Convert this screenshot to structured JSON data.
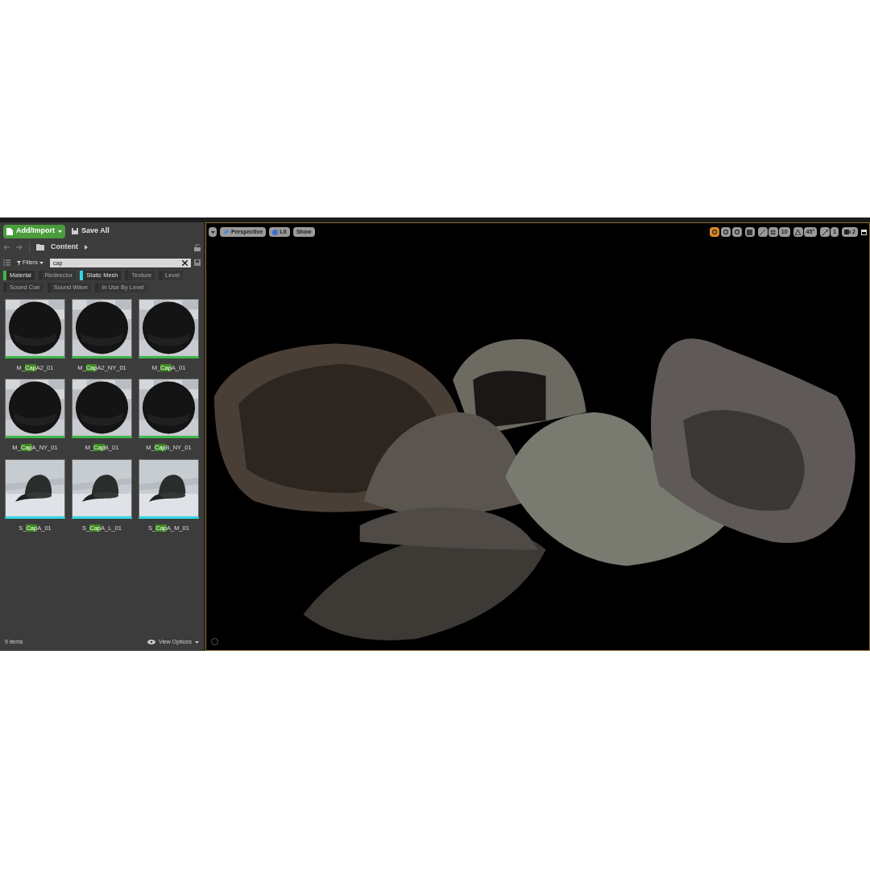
{
  "toolbar": {
    "add_button": "Add/Import",
    "save_button": "Save All"
  },
  "path": {
    "folder": "Content"
  },
  "search": {
    "value": "cap",
    "filters_label": "Filters"
  },
  "filters": [
    {
      "label": "Material",
      "active": true,
      "color": "#3fb64a"
    },
    {
      "label": "Redirector",
      "active": false
    },
    {
      "label": "Static Mesh",
      "active": true,
      "color": "#33d6e6"
    },
    {
      "label": "Texture",
      "active": false
    },
    {
      "label": "Level",
      "active": false
    },
    {
      "label": "Sound Cue",
      "active": false
    },
    {
      "label": "Sound Wave",
      "active": false
    },
    {
      "label": "In Use By Level",
      "active": false
    }
  ],
  "assets": [
    {
      "kind": "material",
      "prefix": "M_",
      "match": "Cap",
      "suffix": "A2_01"
    },
    {
      "kind": "material",
      "prefix": "M_",
      "match": "Cap",
      "suffix": "A2_NY_01"
    },
    {
      "kind": "material",
      "prefix": "M_",
      "match": "Cap",
      "suffix": "A_01"
    },
    {
      "kind": "material",
      "prefix": "M_",
      "match": "Cap",
      "suffix": "A_NY_01"
    },
    {
      "kind": "material",
      "prefix": "M_",
      "match": "Cap",
      "suffix": "B_01"
    },
    {
      "kind": "material",
      "prefix": "M_",
      "match": "Cap",
      "suffix": "B_NY_01"
    },
    {
      "kind": "static_mesh",
      "prefix": "S_",
      "match": "Cap",
      "suffix": "A_01"
    },
    {
      "kind": "static_mesh",
      "prefix": "S_",
      "match": "Cap",
      "suffix": "A_L_01"
    },
    {
      "kind": "static_mesh",
      "prefix": "S_",
      "match": "Cap",
      "suffix": "A_M_01"
    }
  ],
  "status": {
    "count": "9 items",
    "view_options": "View Options"
  },
  "viewport": {
    "perspective": "Perspective",
    "lit": "Lit",
    "show": "Show",
    "grid_snap": "10",
    "rotation_snap": "45°",
    "scale_snap": "1",
    "camera_speed": "2",
    "transform_modes": [
      {
        "selected": true
      },
      {
        "selected": false
      },
      {
        "selected": false
      }
    ]
  }
}
